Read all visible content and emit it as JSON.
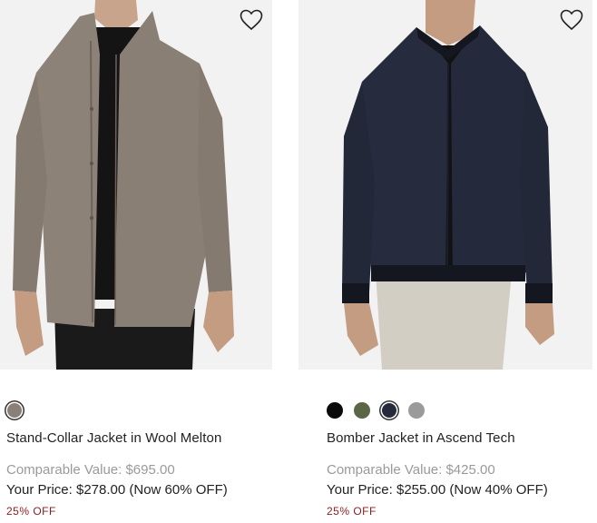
{
  "products": [
    {
      "name": "Stand-Collar Jacket in Wool Melton",
      "comparable_value": "Comparable Value: $695.00",
      "your_price": "Your Price: $278.00 (Now 60% OFF)",
      "promo": "25% OFF",
      "image_icon": "wool-jacket-photo",
      "wishlist_icon": "heart-outline-icon",
      "swatches": [
        {
          "color": "#8b8079",
          "selected": true
        }
      ]
    },
    {
      "name": "Bomber Jacket in Ascend Tech",
      "comparable_value": "Comparable Value: $425.00",
      "your_price": "Your Price: $255.00 (Now 40% OFF)",
      "promo": "25% OFF",
      "image_icon": "bomber-jacket-photo",
      "wishlist_icon": "heart-outline-icon",
      "swatches": [
        {
          "color": "#0a0a0a",
          "selected": false
        },
        {
          "color": "#5b6647",
          "selected": false
        },
        {
          "color": "#252b3d",
          "selected": true
        },
        {
          "color": "#9a9a9a",
          "selected": false
        }
      ]
    }
  ]
}
